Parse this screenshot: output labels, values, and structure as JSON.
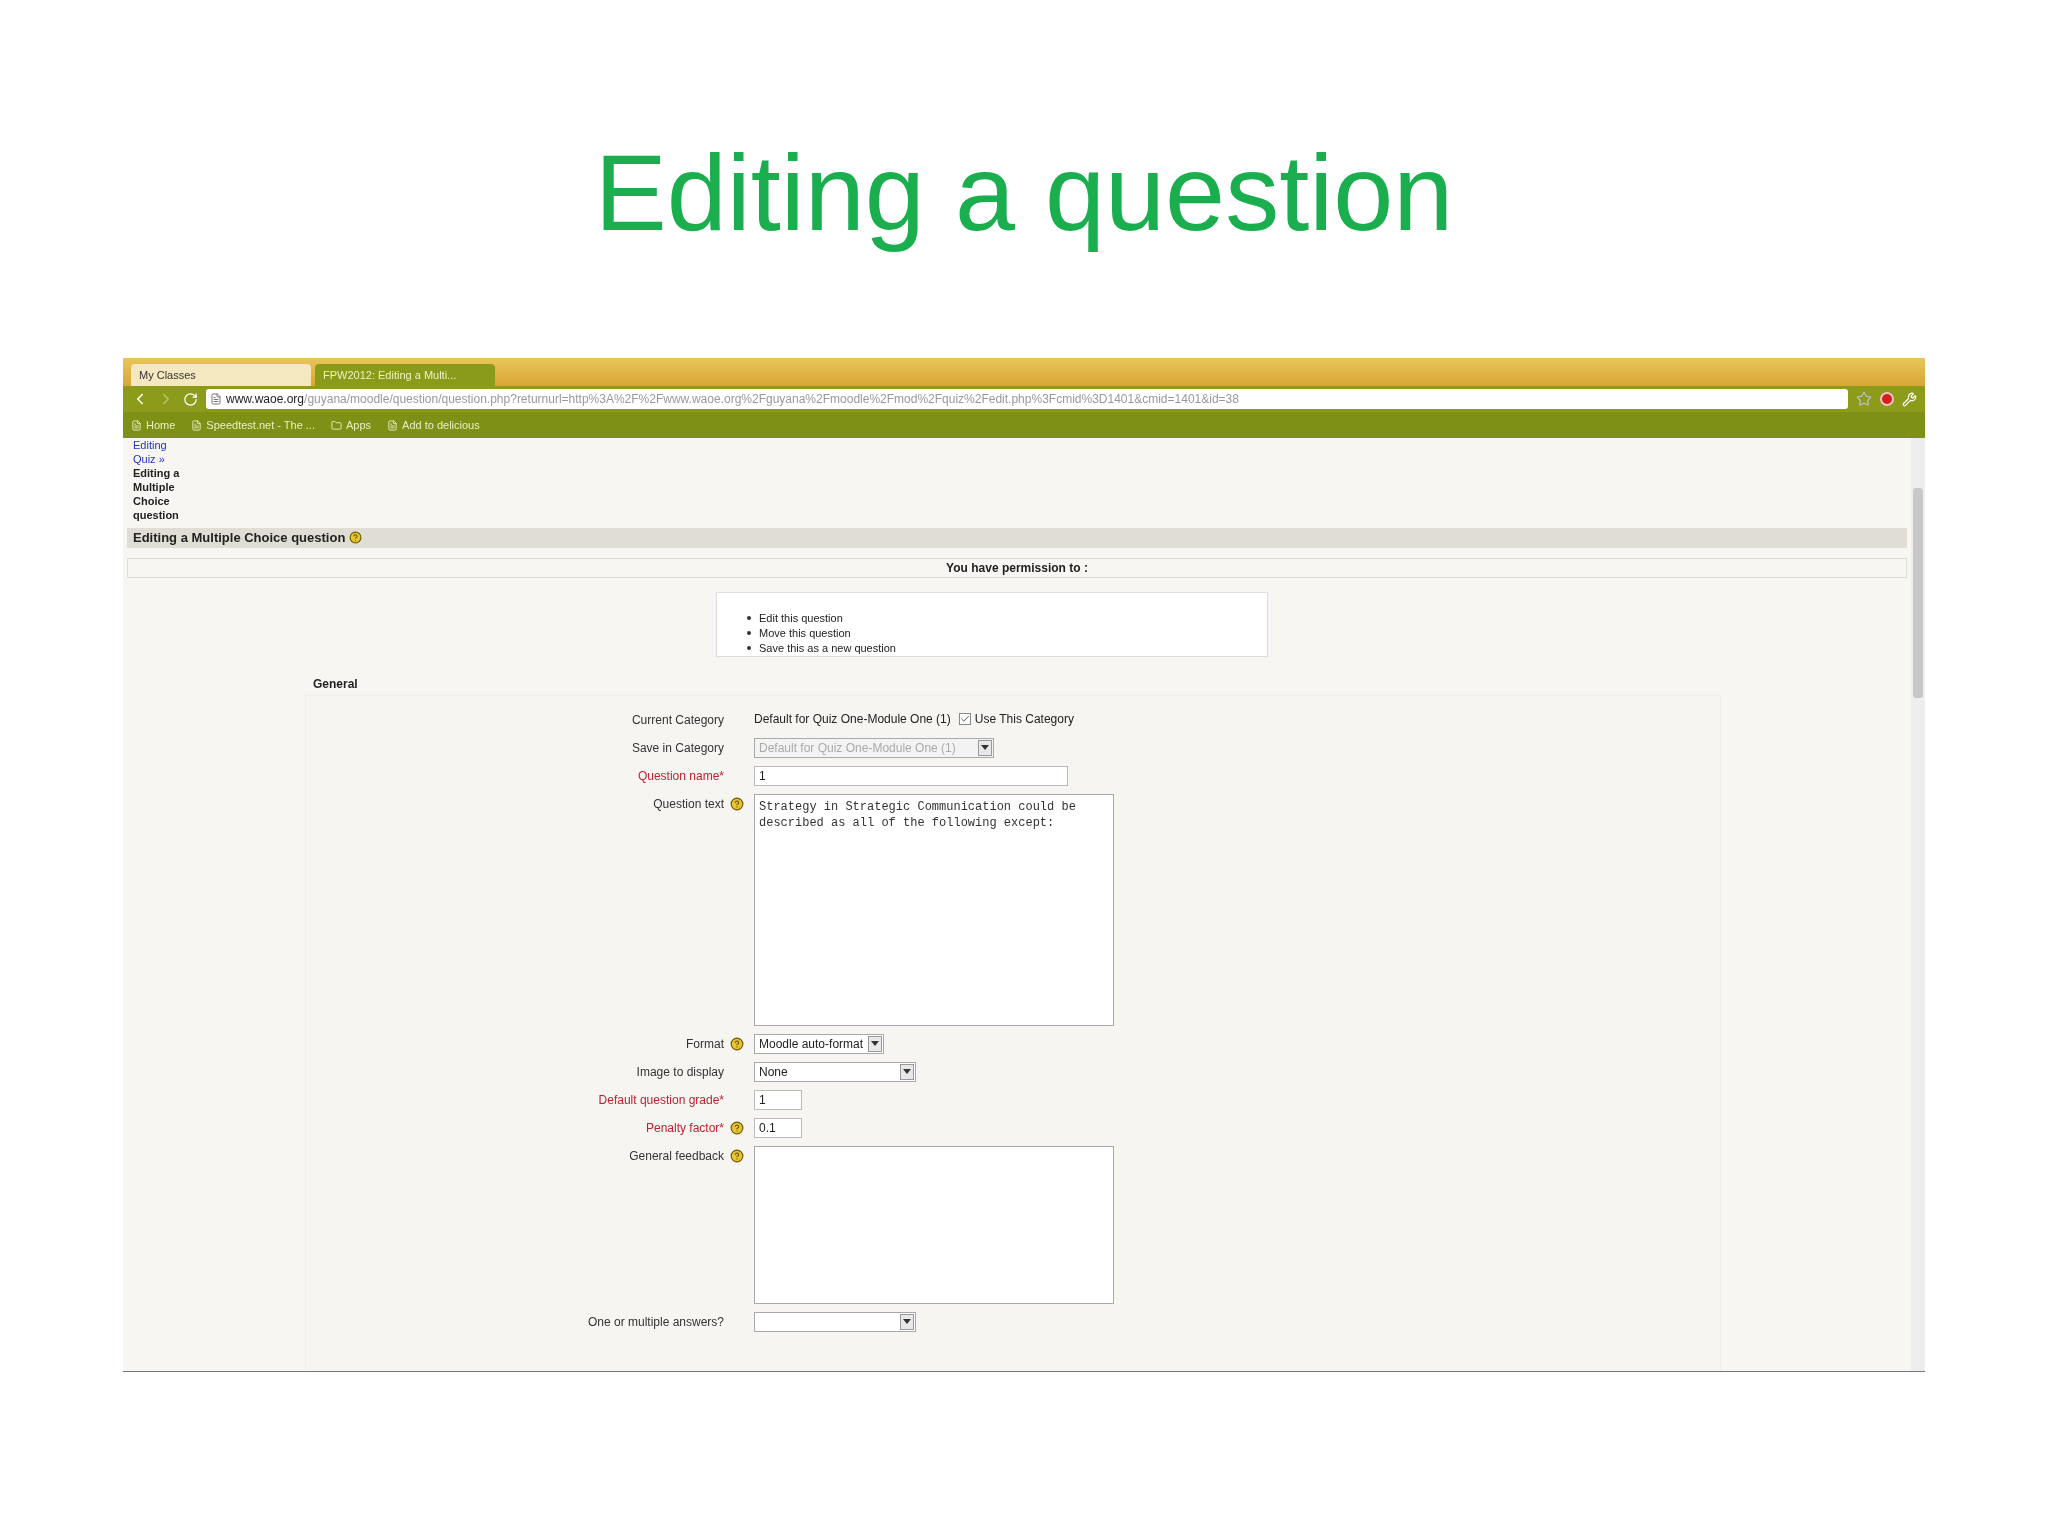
{
  "slide": {
    "title": "Editing a question"
  },
  "browser": {
    "tabs": [
      {
        "label": "My Classes",
        "selected": false
      },
      {
        "label": "FPW2012: Editing a Multi...",
        "selected": true
      }
    ],
    "url_host": "www.waoe.org",
    "url_path": "/guyana/moodle/question/question.php?returnurl=http%3A%2F%2Fwww.waoe.org%2Fguyana%2Fmoodle%2Fmod%2Fquiz%2Fedit.php%3Fcmid%3D1401&cmid=1401&id=38",
    "bookmarks": [
      "Home",
      "Speedtest.net - The ...",
      "Apps",
      "Add to delicious"
    ]
  },
  "breadcrumb": {
    "links": [
      "Editing",
      "Quiz »"
    ],
    "current": "Editing a Multiple Choice question"
  },
  "page_heading": "Editing a Multiple Choice question",
  "permission": {
    "title": "You have permission to :",
    "items": [
      "Edit this question",
      "Move this question",
      "Save this as a new question"
    ]
  },
  "fieldset": {
    "legend": "General",
    "rows": [
      {
        "kind": "text",
        "label": "Current Category",
        "required": false,
        "help": false,
        "value": "Default for Quiz One-Module One (1)",
        "checkbox": {
          "label": "Use This Category",
          "checked": true
        }
      },
      {
        "kind": "select",
        "label": "Save in Category",
        "required": false,
        "help": false,
        "value": "Default for Quiz One-Module One (1)",
        "disabled": true
      },
      {
        "kind": "input",
        "label": "Question name*",
        "required": true,
        "help": false,
        "value": "1"
      },
      {
        "kind": "textarea",
        "label": "Question text",
        "required": false,
        "help": true,
        "value": "Strategy in Strategic Communication could be described as all of the following except:"
      },
      {
        "kind": "select",
        "label": "Format",
        "required": false,
        "help": true,
        "value": "Moodle auto-format",
        "disabled": false
      },
      {
        "kind": "select",
        "label": "Image to display",
        "required": false,
        "help": false,
        "value": "None",
        "disabled": false
      },
      {
        "kind": "input",
        "label": "Default question grade*",
        "required": true,
        "help": false,
        "value": "1"
      },
      {
        "kind": "input",
        "label": "Penalty factor*",
        "required": true,
        "help": true,
        "value": "0.1"
      },
      {
        "kind": "textarea",
        "label": "General feedback",
        "required": false,
        "help": true
      },
      {
        "kind": "select",
        "label": "One or multiple answers?",
        "required": false,
        "help": false,
        "disabled": false
      }
    ]
  }
}
